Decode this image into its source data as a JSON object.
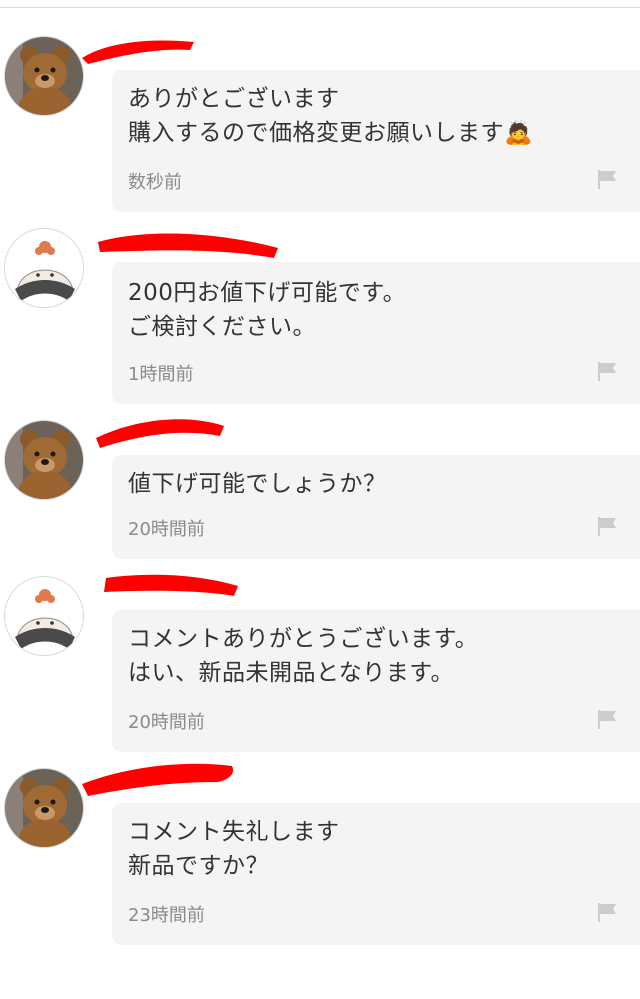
{
  "comments": [
    {
      "text": "ありがとございます\n購入するので価格変更お願いします🙇",
      "time": "数秒前",
      "avatar": "bear-avatar-icon",
      "report_icon": "flag-icon"
    },
    {
      "text": "200円お値下げ可能です。\nご検討ください。",
      "time": "1時間前",
      "avatar": "rice-ball-avatar-icon",
      "report_icon": "flag-icon"
    },
    {
      "text": "値下げ可能でしょうか？",
      "time": "20時間前",
      "avatar": "bear-avatar-icon",
      "report_icon": "flag-icon"
    },
    {
      "text": "コメントありがとうございます。\nはい、新品未開品となります。",
      "time": "20時間前",
      "avatar": "rice-ball-avatar-icon",
      "report_icon": "flag-icon"
    },
    {
      "text": "コメント失礼します\n新品ですか？",
      "time": "23時間前",
      "avatar": "bear-avatar-icon",
      "report_icon": "flag-icon"
    }
  ],
  "colors": {
    "bubble_bg": "#f4f4f4",
    "text": "#333333",
    "time_text": "#8a8a8a",
    "redaction": "#ff0000",
    "flag": "#cccccc"
  }
}
